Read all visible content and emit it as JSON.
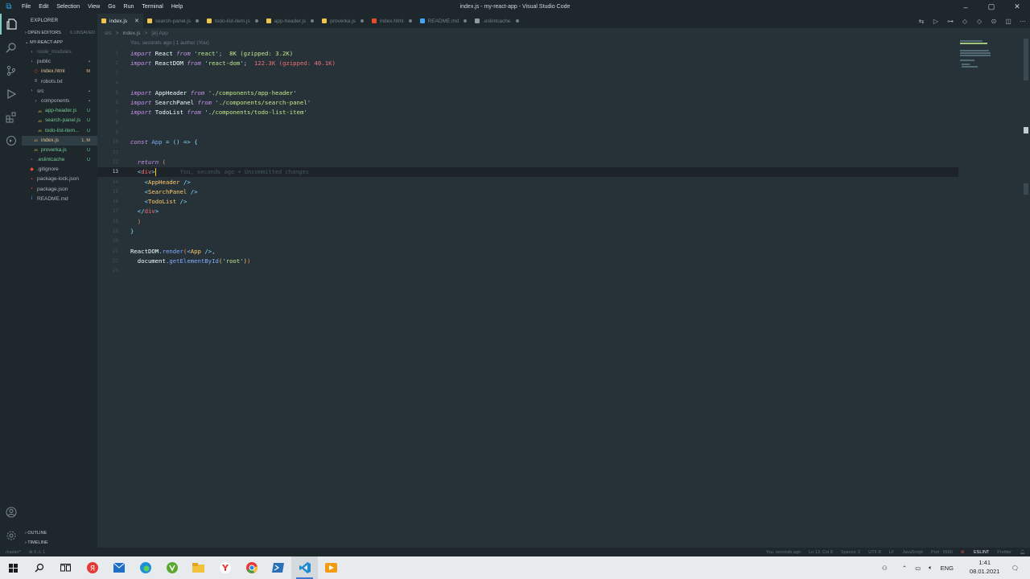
{
  "titlebar": {
    "menu": [
      "File",
      "Edit",
      "Selection",
      "View",
      "Go",
      "Run",
      "Terminal",
      "Help"
    ],
    "window_title": "index.js - my-react-app - Visual Studio Code"
  },
  "sidebar": {
    "title": "EXPLORER",
    "open_editors": {
      "label": "OPEN EDITORS",
      "badge": "6 UNSAVED"
    },
    "project": "MY-REACT-APP",
    "tree": [
      {
        "name": "node_modules",
        "indent": 1,
        "kind": "folder",
        "status": "",
        "color": "#5f6e76"
      },
      {
        "name": "public",
        "indent": 1,
        "kind": "folder",
        "status": "•",
        "color": "#a8b4ba"
      },
      {
        "name": "index.html",
        "indent": 2,
        "kind": "html",
        "status": "M",
        "color": "#e2c08d"
      },
      {
        "name": "robots.txt",
        "indent": 2,
        "kind": "txt",
        "status": "",
        "color": "#a8b4ba"
      },
      {
        "name": "src",
        "indent": 1,
        "kind": "folder",
        "status": "•",
        "color": "#a8b4ba"
      },
      {
        "name": "components",
        "indent": 2,
        "kind": "folder",
        "status": "•",
        "color": "#a8b4ba"
      },
      {
        "name": "app-header.js",
        "indent": 3,
        "kind": "js",
        "status": "U",
        "color": "#73c991"
      },
      {
        "name": "search-panel.js",
        "indent": 3,
        "kind": "js",
        "status": "U",
        "color": "#73c991"
      },
      {
        "name": "todo-list-item...",
        "indent": 3,
        "kind": "js",
        "status": "U",
        "color": "#73c991"
      },
      {
        "name": "index.js",
        "indent": 2,
        "kind": "js",
        "status": "1, M",
        "color": "#e2c08d",
        "selected": true
      },
      {
        "name": "proverka.js",
        "indent": 2,
        "kind": "js",
        "status": "U",
        "color": "#73c991"
      },
      {
        "name": ".eslintcache",
        "indent": 1,
        "kind": "file",
        "status": "U",
        "color": "#73c991"
      },
      {
        "name": ".gitignore",
        "indent": 1,
        "kind": "git",
        "status": "",
        "color": "#a8b4ba"
      },
      {
        "name": "package-lock.json",
        "indent": 1,
        "kind": "npm",
        "status": "",
        "color": "#a8b4ba"
      },
      {
        "name": "package.json",
        "indent": 1,
        "kind": "npm",
        "status": "",
        "color": "#a8b4ba"
      },
      {
        "name": "README.md",
        "indent": 1,
        "kind": "info",
        "status": "",
        "color": "#a8b4ba"
      }
    ],
    "outline": "OUTLINE",
    "timeline": "TIMELINE"
  },
  "tabs": [
    {
      "label": "index.js",
      "active": true,
      "icon": "#f1c54d"
    },
    {
      "label": "search-panel.js",
      "active": false,
      "icon": "#f1c54d"
    },
    {
      "label": "todo-list-item.js",
      "active": false,
      "icon": "#f1c54d"
    },
    {
      "label": "app-header.js",
      "active": false,
      "icon": "#f1c54d"
    },
    {
      "label": "proverka.js",
      "active": false,
      "icon": "#f1c54d"
    },
    {
      "label": "index.html",
      "active": false,
      "icon": "#e44d26"
    },
    {
      "label": "README.md",
      "active": false,
      "icon": "#42a5f5"
    },
    {
      "label": ".eslintcache",
      "active": false,
      "icon": "#8a9ba3"
    }
  ],
  "breadcrumb": [
    "src",
    ">",
    "index.js",
    ">",
    "[ø] App"
  ],
  "editor": {
    "blame": "You, seconds ago | 1 author (You)",
    "inline_blame": "You, seconds ago • Uncommitted changes",
    "current_line": 13,
    "lines": [
      {
        "n": "1",
        "html": "<span class='k'>import</span> <span class='v'>React</span> <span class='k'>from</span> <span class='p'>'</span><span class='s'>react</span><span class='p'>'</span>;  <span class='gz8'>8K (gzipped: 3.2K)</span>"
      },
      {
        "n": "2",
        "html": "<span class='k'>import</span> <span class='v'>ReactDOM</span> <span class='k'>from</span> <span class='p'>'</span><span class='s'>react-dom</span><span class='p'>'</span>;  <span class='gz1'>122.3K (gzipped: 40.1K)</span>"
      },
      {
        "n": "3",
        "html": ""
      },
      {
        "n": "4",
        "html": ""
      },
      {
        "n": "5",
        "html": "<span class='k'>import</span> <span class='v'>AppHeader</span> <span class='k'>from</span> <span class='p'>'</span><span class='s'>./components/app-header</span><span class='p'>'</span>"
      },
      {
        "n": "6",
        "html": "<span class='k'>import</span> <span class='v'>SearchPanel</span> <span class='k'>from</span> <span class='p'>'</span><span class='s'>./components/search-panel</span><span class='p'>'</span>"
      },
      {
        "n": "7",
        "html": "<span class='k'>import</span> <span class='v'>TodoList</span> <span class='k'>from</span> <span class='p'>'</span><span class='s'>./components/todo-list-item</span><span class='p'>'</span>"
      },
      {
        "n": "8",
        "html": ""
      },
      {
        "n": "9",
        "html": ""
      },
      {
        "n": "10",
        "html": "<span class='k'>const</span> <span class='f'>App</span> <span class='p'>=</span> <span class='p'>()</span> <span class='p'>=></span> <span class='p'>{</span>"
      },
      {
        "n": "11",
        "html": ""
      },
      {
        "n": "12",
        "html": "  <span class='k'>return</span> <span class='o'>(</span>"
      },
      {
        "n": "13",
        "html": "  <span class='p'>&lt;</span><span class='t'>div</span><span class='p'>&gt;</span><span class='cursor'></span>"
      },
      {
        "n": "14",
        "html": "    <span class='p'>&lt;</span><span class='y'>AppHeader</span> <span class='p'>/&gt;</span>"
      },
      {
        "n": "15",
        "html": "    <span class='p'>&lt;</span><span class='y'>SearchPanel</span> <span class='p'>/&gt;</span>"
      },
      {
        "n": "16",
        "html": "    <span class='p'>&lt;</span><span class='y'>TodoList</span> <span class='p'>/&gt;</span>"
      },
      {
        "n": "17",
        "html": "  <span class='p'>&lt;/</span><span class='t'>div</span><span class='p'>&gt;</span>"
      },
      {
        "n": "18",
        "html": "  <span class='o'>)</span>"
      },
      {
        "n": "19",
        "html": "<span class='p'>}</span>"
      },
      {
        "n": "20",
        "html": ""
      },
      {
        "n": "21",
        "html": "<span class='v'>ReactDOM</span><span class='p'>.</span><span class='f'>render</span><span class='o'>(</span><span class='p'>&lt;</span><span class='y'>App</span> <span class='p'>/&gt;</span>,"
      },
      {
        "n": "22",
        "html": "  <span class='v'>document</span><span class='p'>.</span><span class='f'>getElementById</span><span class='y'>(</span><span class='p'>'</span><span class='s'>root</span><span class='p'>'</span><span class='y'>)</span><span class='o'>)</span>"
      },
      {
        "n": "23",
        "html": ""
      }
    ]
  },
  "statusbar": {
    "branch": "master*",
    "problems": "⊗ 0 ⚠ 1",
    "blame": "You, seconds ago",
    "position": "Ln 13, Col 8",
    "spaces": "Spaces: 2",
    "encoding": "UTF-8",
    "eol": "LF",
    "language": "JavaScript",
    "port": "Port : 5500",
    "eslint": "ESLINT",
    "prettier": "Prettier"
  },
  "taskbar": {
    "lang": "ENG",
    "time": "1:41",
    "date": "08.01.2021"
  }
}
